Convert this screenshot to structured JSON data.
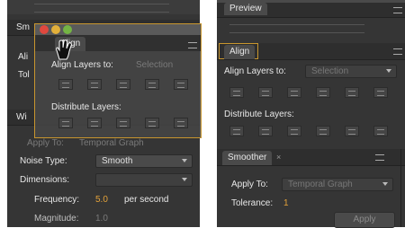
{
  "left": {
    "floating": {
      "tab_label": "Align",
      "align_layers_label": "Align Layers to:",
      "align_to_value": "Selection",
      "distribute_label": "Distribute Layers:"
    },
    "behind": {
      "tab_partial": "Sm",
      "align_partial": "Ali",
      "tolerance_partial": "Tol",
      "wiggler_partial": "Wi"
    },
    "wiggler": {
      "apply_to_label": "Apply To:",
      "apply_to_value": "Temporal Graph",
      "noise_type_label": "Noise Type:",
      "noise_type_value": "Smooth",
      "dimensions_label": "Dimensions:",
      "frequency_label": "Frequency:",
      "frequency_value": "5.0",
      "frequency_unit": "per second",
      "magnitude_label": "Magnitude:",
      "magnitude_value": "1.0"
    }
  },
  "right": {
    "preview_tab": "Preview",
    "align": {
      "tab_label": "Align",
      "align_layers_label": "Align Layers to:",
      "align_to_value": "Selection",
      "distribute_label": "Distribute Layers:"
    },
    "smoother": {
      "tab_label": "Smoother",
      "apply_to_label": "Apply To:",
      "apply_to_value": "Temporal Graph",
      "tolerance_label": "Tolerance:",
      "tolerance_value": "1",
      "apply_button": "Apply"
    }
  },
  "colors": {
    "accent": "#e3a23a",
    "panel": "#3a3a3a",
    "highlight_border": "#c8962e"
  },
  "icons": [
    "close-icon",
    "panel-menu-icon",
    "align-icon",
    "distribute-icon",
    "playback-icon"
  ]
}
